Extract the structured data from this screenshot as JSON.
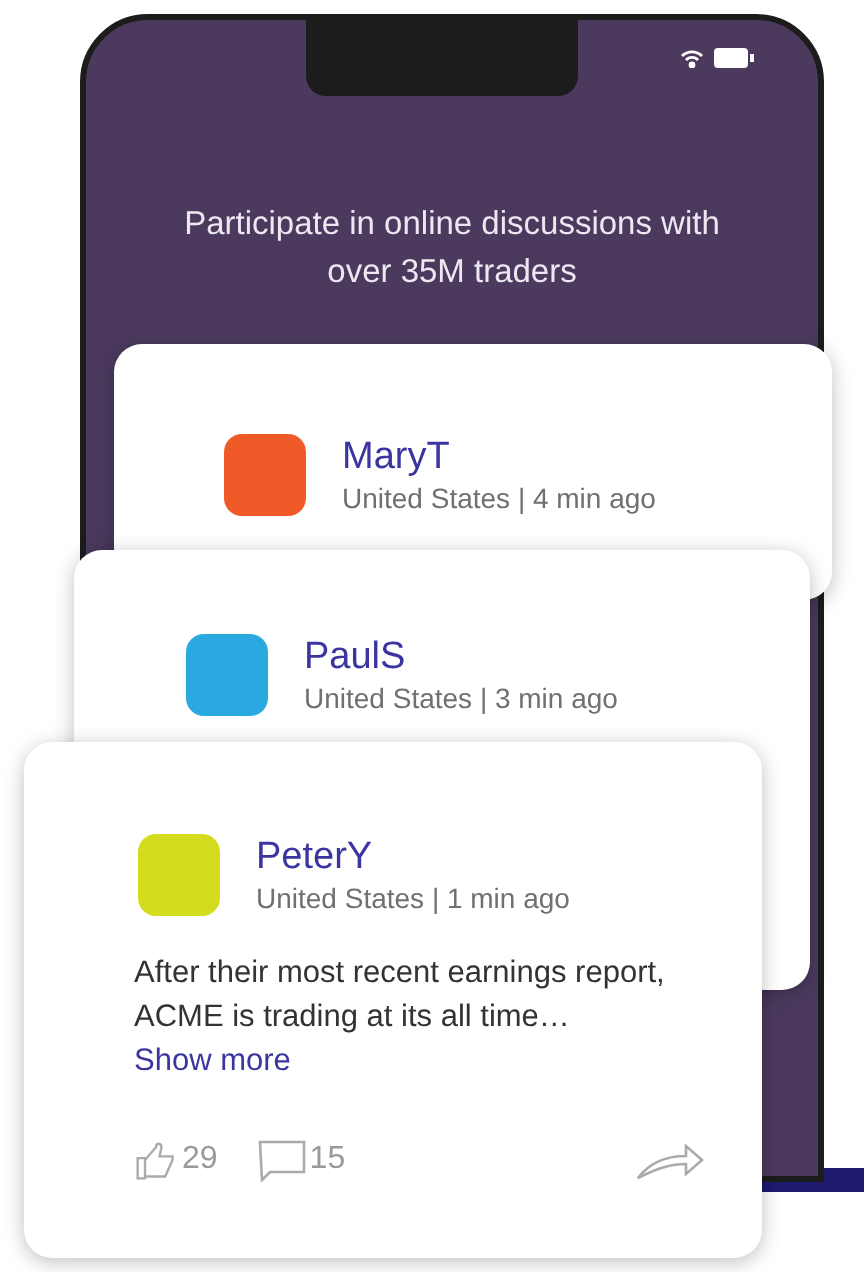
{
  "tagline": "Participate in online discussions with over 35M traders",
  "posts": [
    {
      "name": "MaryT",
      "meta": "United States | 4 min ago",
      "color": "#f05a28"
    },
    {
      "name": "PaulS",
      "meta": "United States | 3 min ago",
      "color": "#2aa8e0"
    },
    {
      "name": "PeterY",
      "meta": "United States | 1 min ago",
      "color": "#d4dc1e",
      "body": "After their most recent earnings report, ACME is trading at its all time…",
      "show_more": "Show more",
      "likes": "29",
      "comments": "15"
    }
  ]
}
